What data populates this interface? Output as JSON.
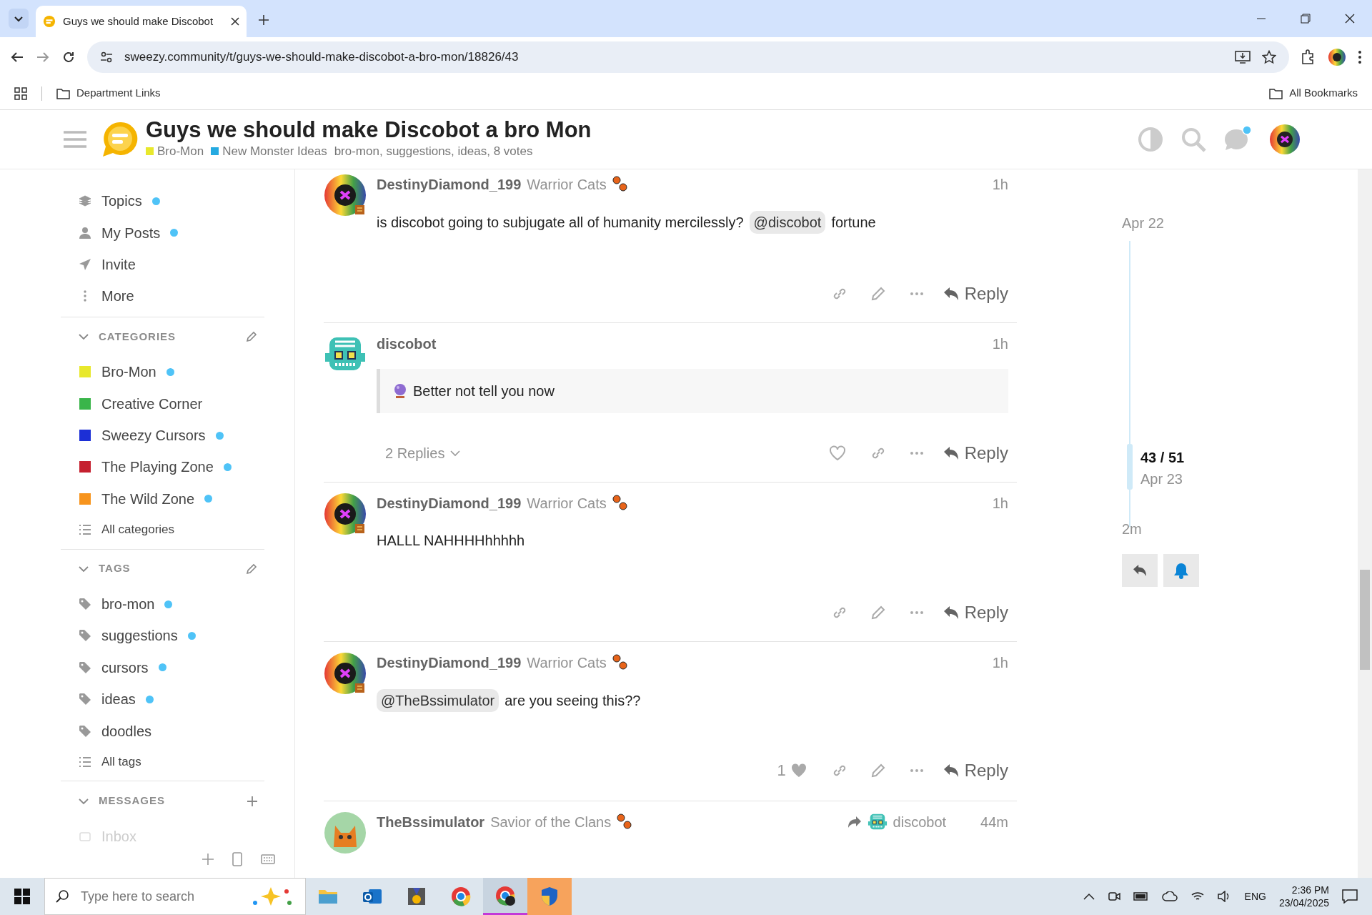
{
  "browser": {
    "tab_title": "Guys we should make Discobot",
    "url": "sweezy.community/t/guys-we-should-make-discobot-a-bro-mon/18826/43",
    "bookmarks": [
      "Department Links"
    ],
    "all_bookmarks": "All Bookmarks"
  },
  "header": {
    "title": "Guys we should make Discobot a bro Mon",
    "categories": [
      {
        "label": "Bro-Mon",
        "color": "#e8e82c"
      },
      {
        "label": "New Monster Ideas",
        "color": "#25aae1"
      }
    ],
    "tags": "bro-mon, suggestions, ideas, 8 votes",
    "notification": true
  },
  "sidebar": {
    "nav": [
      {
        "label": "Topics",
        "kind": "layers",
        "unread": true
      },
      {
        "label": "My Posts",
        "kind": "user",
        "unread": true
      },
      {
        "label": "Invite",
        "kind": "send",
        "unread": false
      },
      {
        "label": "More",
        "kind": "dots",
        "unread": false
      }
    ],
    "sections": [
      {
        "heading": "CATEGORIES",
        "kind": "edit",
        "items": [
          {
            "label": "Bro-Mon",
            "kind": "square",
            "color": "#e8e82c",
            "unread": true
          },
          {
            "label": "Creative Corner",
            "kind": "square",
            "color": "#3ab54a",
            "unread": false
          },
          {
            "label": "Sweezy Cursors",
            "kind": "square",
            "color": "#1c2fd6",
            "unread": true
          },
          {
            "label": "The Playing Zone",
            "kind": "square",
            "color": "#c5202f",
            "unread": true
          },
          {
            "label": "The Wild Zone",
            "kind": "square",
            "color": "#f7941d",
            "unread": true
          }
        ],
        "all": "All categories"
      },
      {
        "heading": "TAGS",
        "kind": "edit",
        "items": [
          {
            "label": "bro-mon",
            "kind": "tag",
            "unread": true
          },
          {
            "label": "suggestions",
            "kind": "tag",
            "unread": true
          },
          {
            "label": "cursors",
            "kind": "tag",
            "unread": true
          },
          {
            "label": "ideas",
            "kind": "tag",
            "unread": true
          },
          {
            "label": "doodles",
            "kind": "tag",
            "unread": false
          }
        ],
        "all": "All tags"
      },
      {
        "heading": "MESSAGES",
        "kind": "add",
        "items": [
          {
            "label": "Inbox",
            "kind": "inbox",
            "unread": false
          }
        ]
      }
    ]
  },
  "posts": [
    {
      "author": "DestinyDiamond_199",
      "user_title": "Warrior Cats",
      "avatar": {
        "kind": "rainbow"
      },
      "time": "1h",
      "body": [
        {
          "kind": "text",
          "text": "is discobot going to subjugate all of humanity mercilessly?"
        },
        {
          "kind": "mention",
          "text": "@discobot"
        },
        {
          "kind": "text",
          "text": "fortune"
        }
      ],
      "actions": [
        {
          "kind": "link"
        },
        {
          "kind": "edit"
        },
        {
          "kind": "more"
        },
        {
          "kind": "reply",
          "label": "Reply"
        }
      ]
    },
    {
      "author": "discobot",
      "avatar": {
        "kind": "robot"
      },
      "time": "1h",
      "quote": "Better not tell you now",
      "replies": "2 Replies",
      "actions": [
        {
          "kind": "like",
          "liked": false
        },
        {
          "kind": "link"
        },
        {
          "kind": "more"
        },
        {
          "kind": "reply",
          "label": "Reply"
        }
      ]
    },
    {
      "author": "DestinyDiamond_199",
      "user_title": "Warrior Cats",
      "avatar": {
        "kind": "rainbow"
      },
      "time": "1h",
      "body": [
        {
          "kind": "text",
          "text": "HALLL NAHHHHhhhhh"
        }
      ],
      "actions": [
        {
          "kind": "link"
        },
        {
          "kind": "edit"
        },
        {
          "kind": "more"
        },
        {
          "kind": "reply",
          "label": "Reply"
        }
      ]
    },
    {
      "author": "DestinyDiamond_199",
      "user_title": "Warrior Cats",
      "avatar": {
        "kind": "rainbow"
      },
      "time": "1h",
      "body": [
        {
          "kind": "mention",
          "text": "@TheBssimulator"
        },
        {
          "kind": "text",
          "text": "are you seeing this??"
        }
      ],
      "actions": [
        {
          "kind": "like",
          "liked": true,
          "count": "1"
        },
        {
          "kind": "link"
        },
        {
          "kind": "edit"
        },
        {
          "kind": "more"
        },
        {
          "kind": "reply",
          "label": "Reply"
        }
      ]
    },
    {
      "author": "TheBssimulator",
      "user_title": "Savior of the Clans",
      "avatar": {
        "kind": "cat"
      },
      "time": "44m",
      "reply_to": "discobot"
    }
  ],
  "timeline": {
    "start": "Apr 22",
    "position": "43 / 51",
    "date": "Apr 23",
    "end": "2m"
  },
  "taskbar": {
    "search_placeholder": "Type here to search",
    "language": "ENG",
    "time": "2:36 PM",
    "date": "23/04/2025"
  }
}
